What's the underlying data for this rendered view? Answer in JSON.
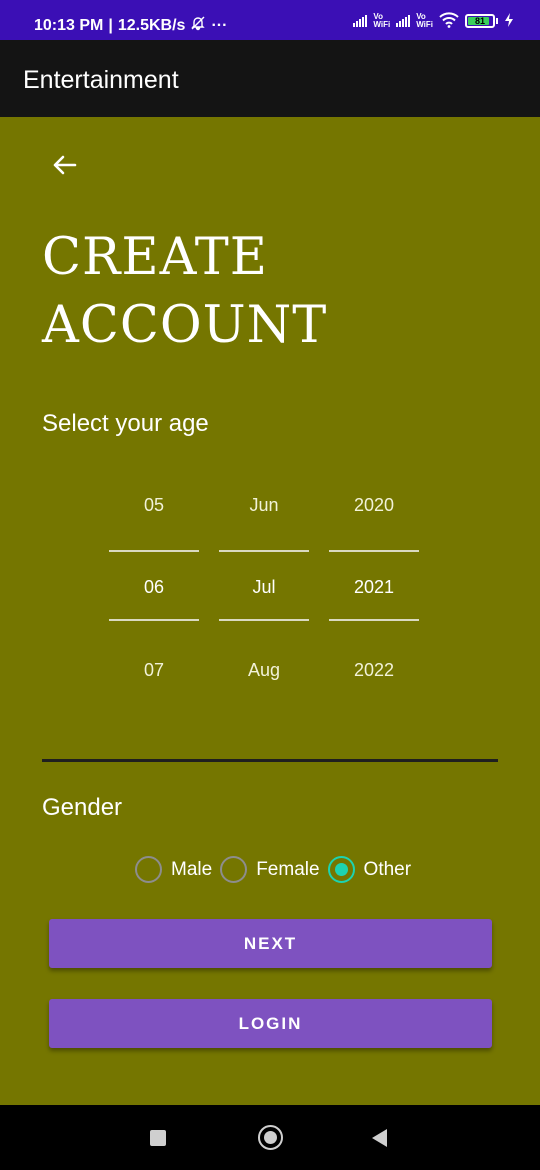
{
  "status_bar": {
    "time": "10:13 PM",
    "speed": "12.5KB/s",
    "more": "···",
    "vo_top": "Vo",
    "vo_bottom": "WiFi",
    "battery": "81"
  },
  "app_bar": {
    "title": "Entertainment"
  },
  "page": {
    "heading_line1": "CREATE",
    "heading_line2": "ACCOUNT",
    "age_label": "Select your age",
    "gender_label": "Gender"
  },
  "date_picker": {
    "day": {
      "prev": "05",
      "current": "06",
      "next": "07"
    },
    "month": {
      "prev": "Jun",
      "current": "Jul",
      "next": "Aug"
    },
    "year": {
      "prev": "2020",
      "current": "2021",
      "next": "2022"
    }
  },
  "gender": {
    "options": [
      {
        "label": "Male",
        "checked": false
      },
      {
        "label": "Female",
        "checked": false
      },
      {
        "label": "Other",
        "checked": true
      }
    ]
  },
  "buttons": {
    "next_label": "NEXT",
    "login_label": "LOGIN"
  },
  "colors": {
    "background": "#757600",
    "status_bar": "#3b0fb5",
    "app_bar": "#141414",
    "button": "#7e52c0",
    "radio_accent": "#1dd3b0"
  },
  "icons": {
    "back": "arrow-left-icon",
    "nav_recents": "square-icon",
    "nav_home": "circle-icon",
    "nav_back": "triangle-back-icon"
  }
}
